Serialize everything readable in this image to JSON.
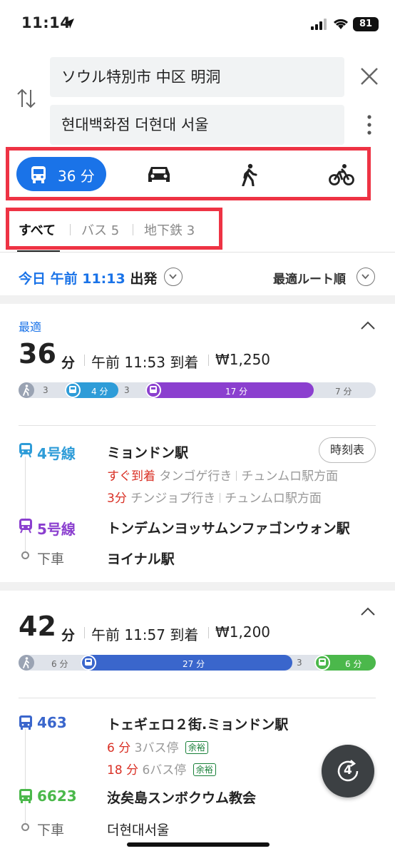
{
  "status_bar": {
    "time": "11:14",
    "battery": "81"
  },
  "search": {
    "origin": "ソウル特別市 中区 明洞",
    "destination": "현대백화점 더현대 서울"
  },
  "modes": {
    "transit_label": "36 分"
  },
  "tabs": [
    {
      "label": "すべて"
    },
    {
      "label": "バス 5"
    },
    {
      "label": "地下鉄 3"
    }
  ],
  "departure": {
    "prefix": "今日 午前 11:13",
    "suffix": "出発",
    "sort_label": "最適ルート順"
  },
  "routes": [
    {
      "badge": "最適",
      "duration": "36",
      "unit": "分",
      "arrival": "午前 11:53 到着",
      "fare": "₩1,250",
      "segments": [
        "3",
        "4 分",
        "3",
        "17 分",
        "7 分"
      ],
      "legs": [
        {
          "line": "4号線",
          "station": "ミョンドン駅",
          "timetable": "時刻表",
          "infos": [
            {
              "when": "すぐ到着",
              "dest": "タンゴゲ行き",
              "dir": "チュンムロ駅方面"
            },
            {
              "when": "3分",
              "dest": "チンジョプ行き",
              "dir": "チュンムロ駅方面"
            }
          ]
        },
        {
          "line": "5号線",
          "station": "トンデムンヨッサムンファゴンウォン駅"
        }
      ],
      "alight": {
        "label": "下車",
        "station": "ヨイナル駅"
      }
    },
    {
      "duration": "42",
      "unit": "分",
      "arrival": "午前 11:57 到着",
      "fare": "₩1,200",
      "segments": [
        "6 分",
        "27 分",
        "3",
        "6 分"
      ],
      "legs": [
        {
          "line": "463",
          "station": "トェギェロ２街.ミョンドン駅",
          "infos": [
            {
              "when": "6 分",
              "stops": "3バス停",
              "tag": "余裕"
            },
            {
              "when": "18 分",
              "stops": "6バス停",
              "tag": "余裕"
            }
          ]
        },
        {
          "line": "6623",
          "station": "汝矣島スンボクウム教会"
        }
      ],
      "alight": {
        "label": "下車",
        "station": "더현대서울"
      }
    }
  ],
  "fab": {
    "count": "4"
  },
  "colors": {
    "accent": "#1a73e8",
    "line4": "#2e9cd8",
    "line5": "#8b3fcf",
    "bus_blue": "#3a66cc",
    "bus_green": "#4bb84b",
    "highlight": "#ee3344",
    "late_red": "#d93025"
  }
}
